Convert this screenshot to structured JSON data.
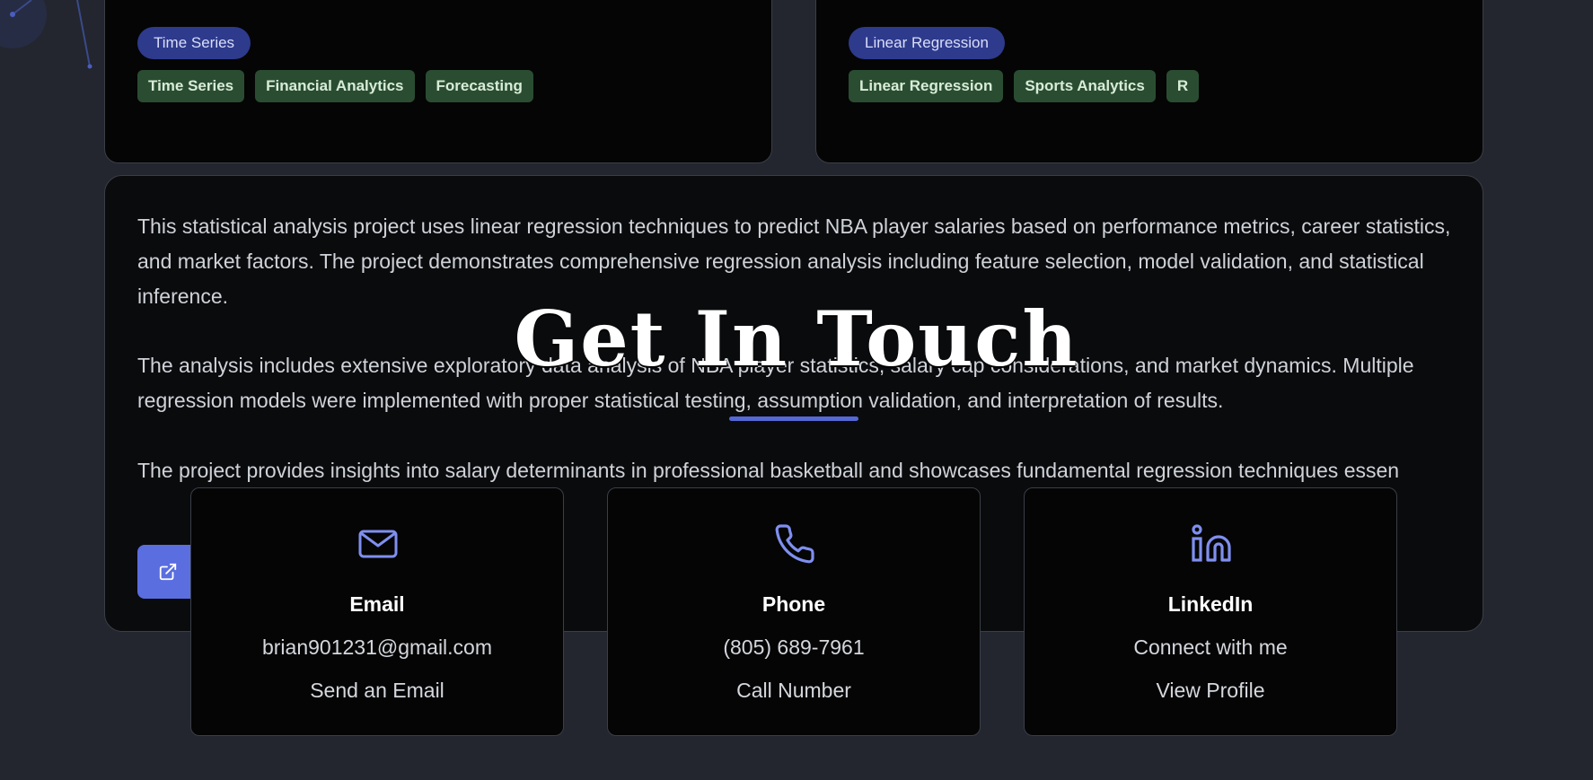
{
  "projects": {
    "time_series": {
      "category": "Time Series",
      "tags": [
        "Time Series",
        "Financial Analytics",
        "Forecasting"
      ]
    },
    "linear_regression": {
      "category": "Linear Regression",
      "tags": [
        "Linear Regression",
        "Sports Analytics",
        "R"
      ]
    }
  },
  "detail": {
    "paragraphs": [
      "This statistical analysis project uses linear regression techniques to predict NBA player salaries based on performance metrics, career statistics, and market factors. The project demonstrates comprehensive regression analysis including feature selection, model validation, and statistical inference.",
      "The analysis includes extensive exploratory data analysis of NBA player statistics, salary cap considerations, and market dynamics. Multiple regression models were implemented with proper statistical testing, assumption validation, and interpretation of results.",
      "The project provides insights into salary determinants in professional basketball and showcases fundamental regression techniques essen"
    ],
    "button_icon": "external-link-icon"
  },
  "contact": {
    "title": "Get In Touch",
    "accent_color": "#5568d6",
    "cards": [
      {
        "icon": "mail-icon",
        "title": "Email",
        "value": "brian901231@gmail.com",
        "action": "Send an Email"
      },
      {
        "icon": "phone-icon",
        "title": "Phone",
        "value": "(805) 689-7961",
        "action": "Call Number"
      },
      {
        "icon": "linkedin-icon",
        "title": "LinkedIn",
        "value": "Connect with me",
        "action": "View Profile"
      }
    ]
  }
}
